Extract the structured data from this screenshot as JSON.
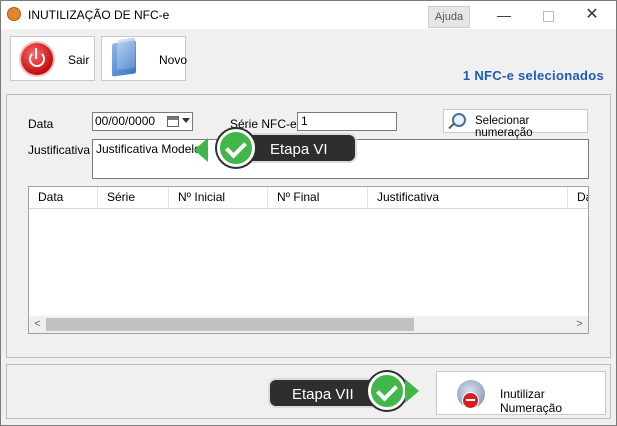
{
  "window": {
    "title": "INUTILIZAÇÃO DE NFC-e",
    "help_label": "Ajuda",
    "minimize_glyph": "—",
    "close_glyph": "✕"
  },
  "toolbar": {
    "exit_label": "Sair",
    "new_label": "Novo"
  },
  "status": {
    "selected_text": "1 NFC-e selecionados"
  },
  "form": {
    "date_label": "Data",
    "date_value": "00/00/0000",
    "series_label": "Série NFC-e",
    "series_value": "1",
    "select_button_label": "Selecionar numeração",
    "justification_label": "Justificativa",
    "justification_value": "Justificativa Modelo"
  },
  "grid": {
    "columns": [
      "Data",
      "Série",
      "Nº Inicial",
      "Nº Final",
      "Justificativa",
      "Da"
    ]
  },
  "actions": {
    "inutilize_label": "Inutilizar Numeração"
  },
  "callouts": {
    "step6": "Etapa VI",
    "step7": "Etapa VII"
  },
  "colors": {
    "accent_blue": "#1f5bb5",
    "callout_bg": "#2d2f2d",
    "check_green": "#41b649"
  }
}
